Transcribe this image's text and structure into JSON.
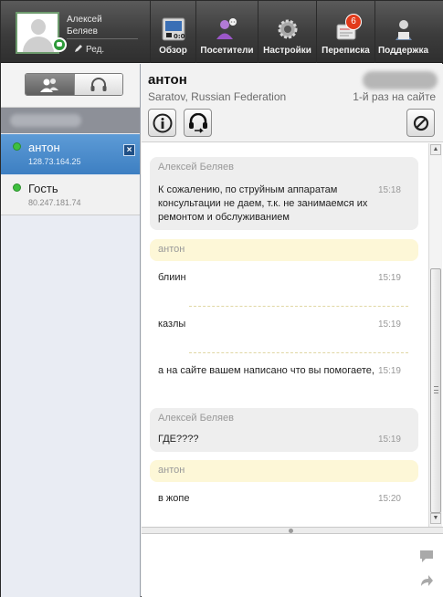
{
  "operator": {
    "name": "Алексей\nБеляев",
    "edit_label": "Ред."
  },
  "nav": [
    {
      "id": "overview",
      "label": "Обзор",
      "icon": "monitor-icon"
    },
    {
      "id": "visitors",
      "label": "Посетители",
      "icon": "visitors-icon"
    },
    {
      "id": "settings",
      "label": "Настройки",
      "icon": "gear-icon"
    },
    {
      "id": "chats",
      "label": "Переписка",
      "icon": "chat-icon",
      "badge": "6"
    },
    {
      "id": "support",
      "label": "Поддержка",
      "icon": "support-icon"
    }
  ],
  "visitors": [
    {
      "name": "антон",
      "ip": "128.73.164.25",
      "selected": true
    },
    {
      "name": "Гость",
      "ip": "80.247.181.74",
      "selected": false
    }
  ],
  "chat": {
    "visitor_name": "антон",
    "location": "Saratov, Russian Federation",
    "visit": "1-й раз на сайте",
    "messages": [
      {
        "sender": "Алексей Беляев",
        "type": "operator",
        "lines": [
          {
            "text": "К сожалению, по струйным аппаратам консультации не даем, т.к. не занимаемся их ремонтом и обслуживанием",
            "time": "15:18"
          }
        ]
      },
      {
        "sender": "антон",
        "type": "visitor",
        "lines": [
          {
            "text": "блиин",
            "time": "15:19"
          },
          {
            "text": "казлы",
            "time": "15:19"
          },
          {
            "text": "а на сайте вашем написано что вы помогаете,",
            "time": "15:19"
          }
        ]
      },
      {
        "sender": "Алексей Беляев",
        "type": "operator",
        "lines": [
          {
            "text": "ГДЕ????",
            "time": "15:19"
          }
        ]
      },
      {
        "sender": "антон",
        "type": "visitor",
        "lines": [
          {
            "text": "в жопе",
            "time": "15:20"
          }
        ]
      }
    ]
  },
  "colors": {
    "topbar": "#3c3c3c",
    "selected_visitor": "#4a8bcb",
    "online": "#3ec03e",
    "visitor_bubble": "#fdf7d7",
    "operator_bubble": "#eeeeee",
    "badge": "#e23a1a"
  }
}
